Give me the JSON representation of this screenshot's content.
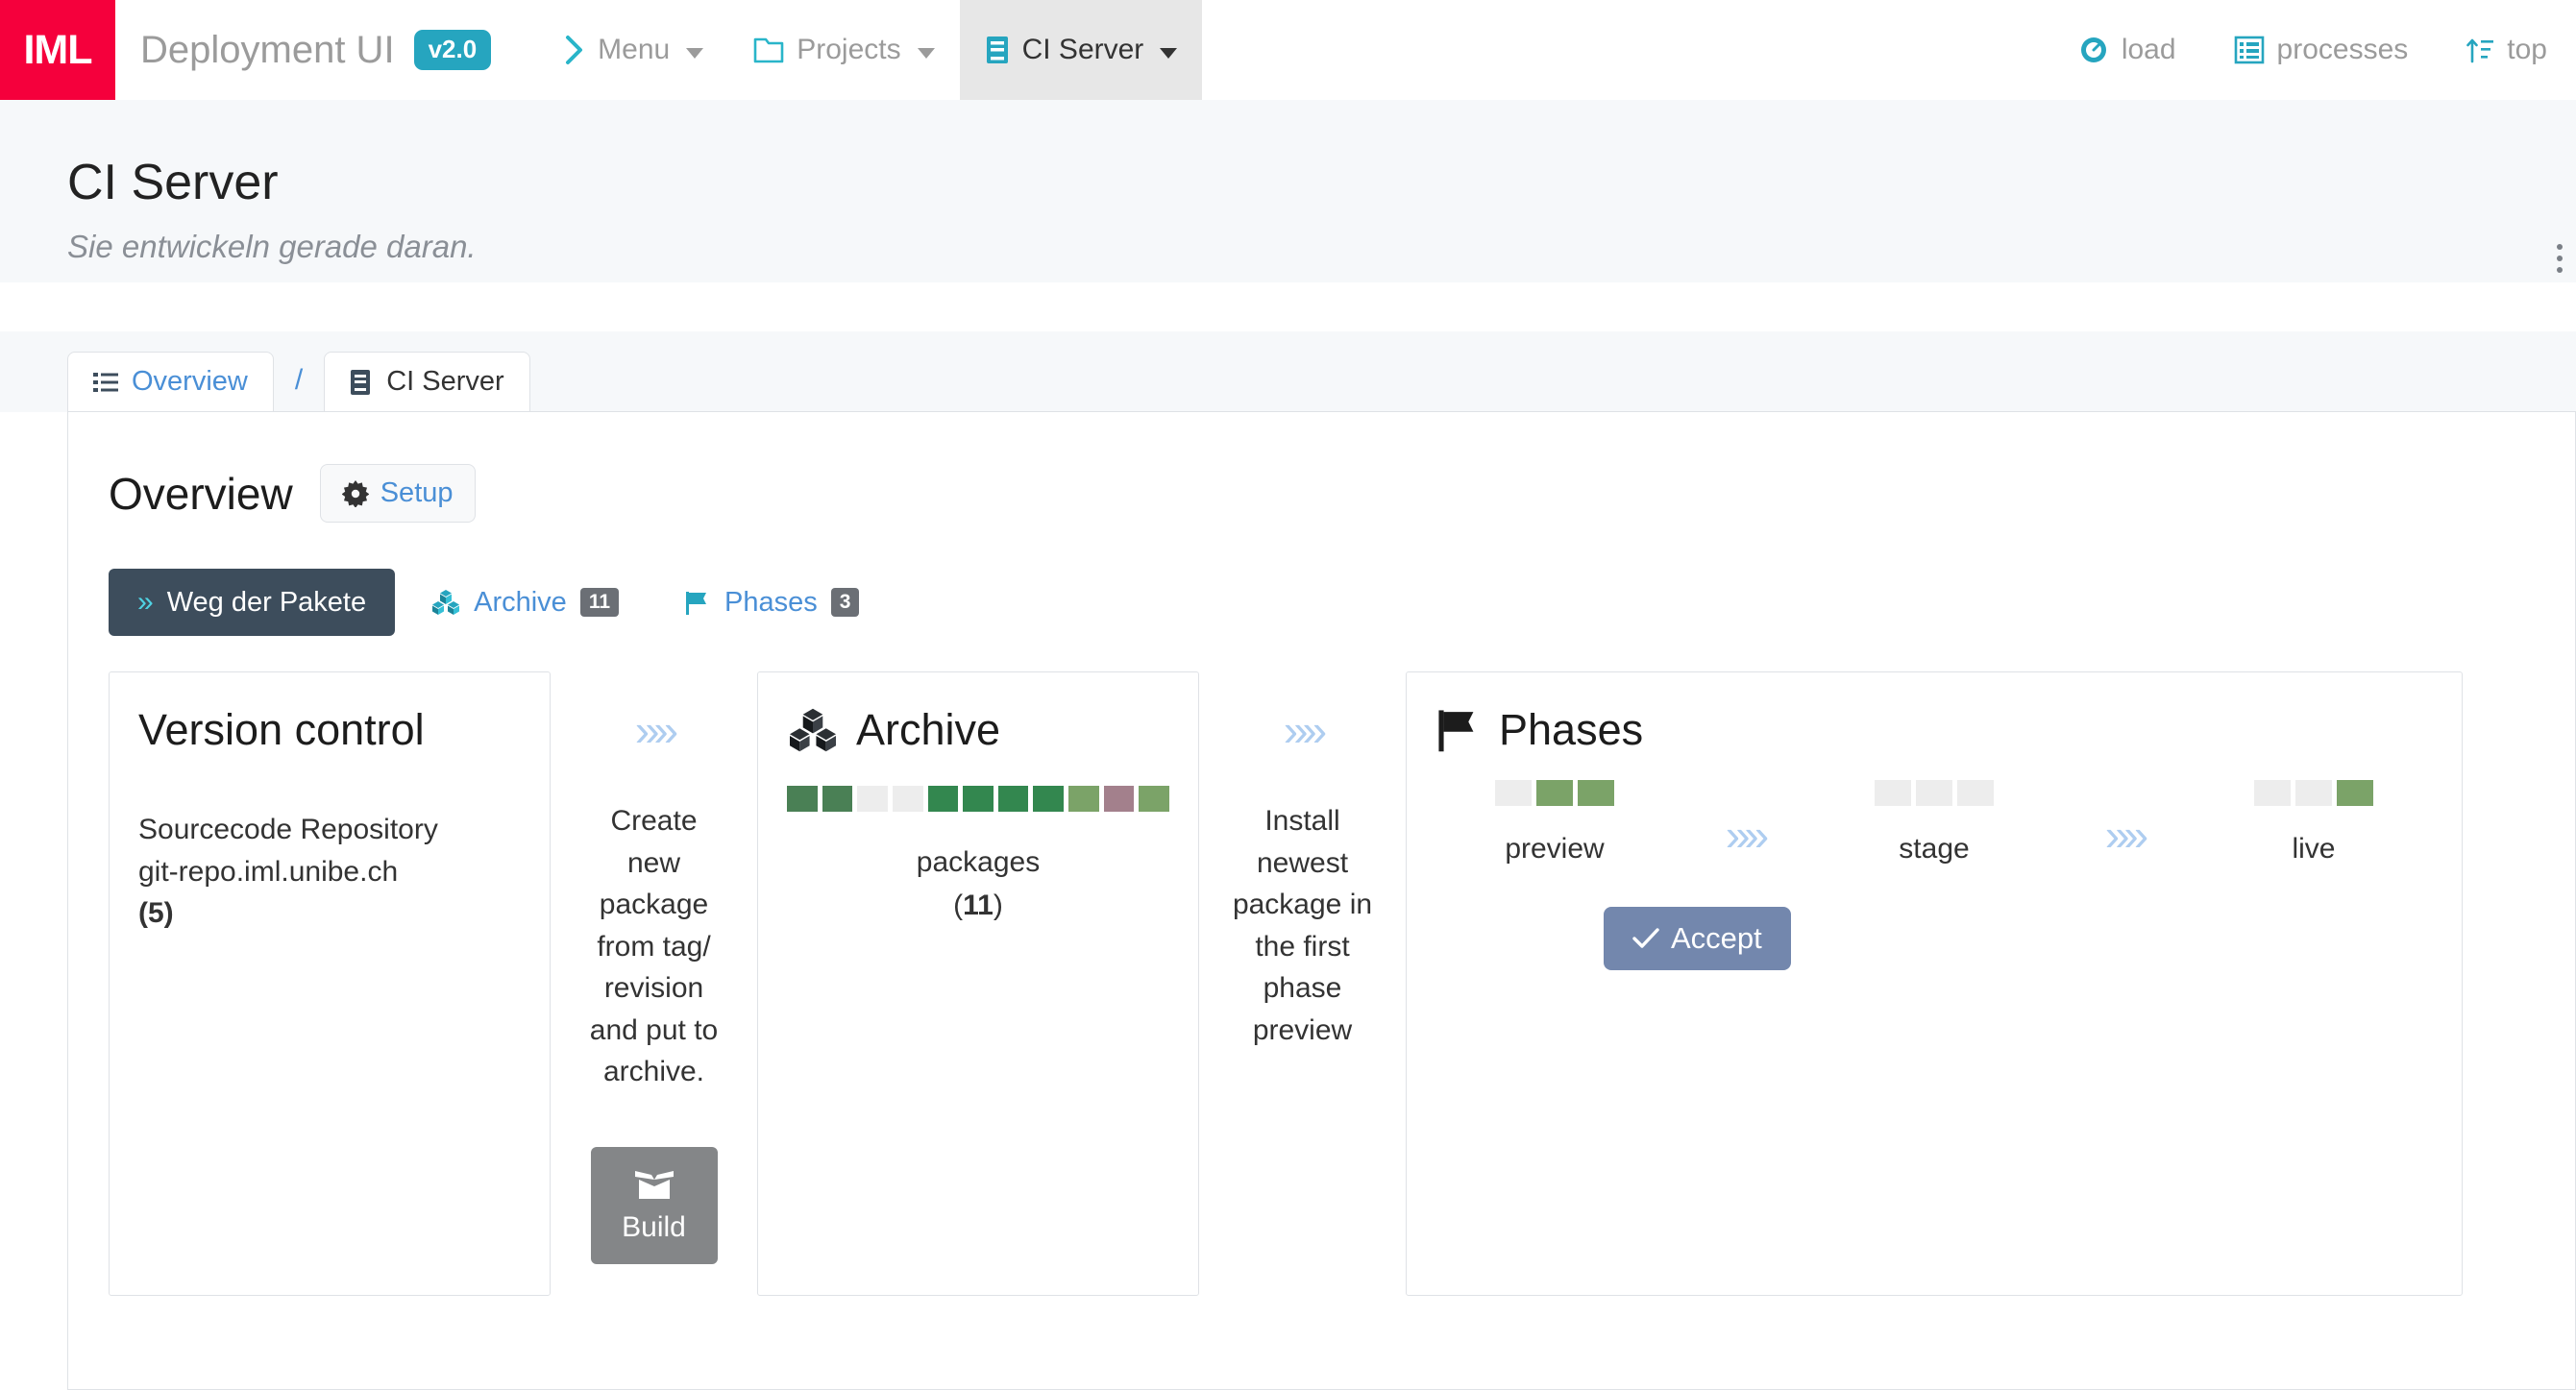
{
  "navbar": {
    "logo": "IML",
    "brand": "Deployment UI",
    "version": "v2.0",
    "items": [
      {
        "label": "Menu",
        "icon": "chevron-right-icon",
        "glyph": "›",
        "caret": true,
        "active": false
      },
      {
        "label": "Projects",
        "icon": "folder-icon",
        "caret": true,
        "active": false
      },
      {
        "label": "CI Server",
        "icon": "server-icon",
        "caret": true,
        "active": true
      }
    ],
    "right_items": [
      {
        "label": "load",
        "icon": "gauge-icon"
      },
      {
        "label": "processes",
        "icon": "list-table-icon"
      },
      {
        "label": "top",
        "icon": "sort-up-icon"
      }
    ]
  },
  "page": {
    "title": "CI Server",
    "subtitle": "Sie entwickeln gerade daran.",
    "menu_icon": "kebab-menu-icon"
  },
  "breadcrumb": {
    "items": [
      {
        "label": "Overview",
        "icon": "list-icon",
        "current": false
      },
      {
        "label": "CI Server",
        "icon": "server-icon",
        "current": true
      }
    ],
    "separator": "/"
  },
  "panel": {
    "title": "Overview",
    "setup_label": "Setup",
    "setup_icon": "gear-icon"
  },
  "tabs": [
    {
      "label": "Weg der Pakete",
      "icon": "double-chevron-icon",
      "badge": "",
      "active": true
    },
    {
      "label": "Archive",
      "icon": "cubes-icon",
      "badge": "11",
      "active": false
    },
    {
      "label": "Phases",
      "icon": "flag-icon",
      "badge": "3",
      "active": false
    }
  ],
  "flow": {
    "version_control": {
      "title": "Version control",
      "line1": "Sourcecode Repository",
      "line2": "git-repo.iml.unibe.ch",
      "count": "(5)",
      "count_value": "5"
    },
    "build_step": {
      "arrows": "»»",
      "text": "Create new package from tag/ revision and put to archive.",
      "button_label": "Build",
      "button_icon": "open-box-icon"
    },
    "archive": {
      "title": "Archive",
      "icon": "cubes-icon",
      "caption": "packages",
      "count": "(11)",
      "count_value": "11",
      "swatches": [
        "#4a8055",
        "#4a8055",
        "#ededed",
        "#ededed",
        "#33874f",
        "#33874f",
        "#33874f",
        "#33874f",
        "#7ba368",
        "#a3808c",
        "#7ba368"
      ]
    },
    "install_step": {
      "arrows": "»»",
      "text": "Install newest package in the first phase preview"
    },
    "phases": {
      "title": "Phases",
      "icon": "flag-icon",
      "accept_label": "Accept",
      "accept_icon": "check-icon",
      "arrows": "»»",
      "columns": [
        {
          "label": "preview",
          "swatches": [
            "#ededed",
            "#7ba368",
            "#7ba368"
          ]
        },
        {
          "label": "stage",
          "swatches": [
            "#ededed",
            "#ededed",
            "#ededed"
          ]
        },
        {
          "label": "live",
          "swatches": [
            "#ededed",
            "#ededed",
            "#7ba368"
          ]
        }
      ]
    }
  },
  "colors": {
    "brand_red": "#f5003c",
    "accent_teal": "#26a5bf",
    "link_blue": "#4a8fd6",
    "tab_active_bg": "#3d4d5c",
    "accept_blue": "#7387ad",
    "build_gray": "#848688"
  }
}
